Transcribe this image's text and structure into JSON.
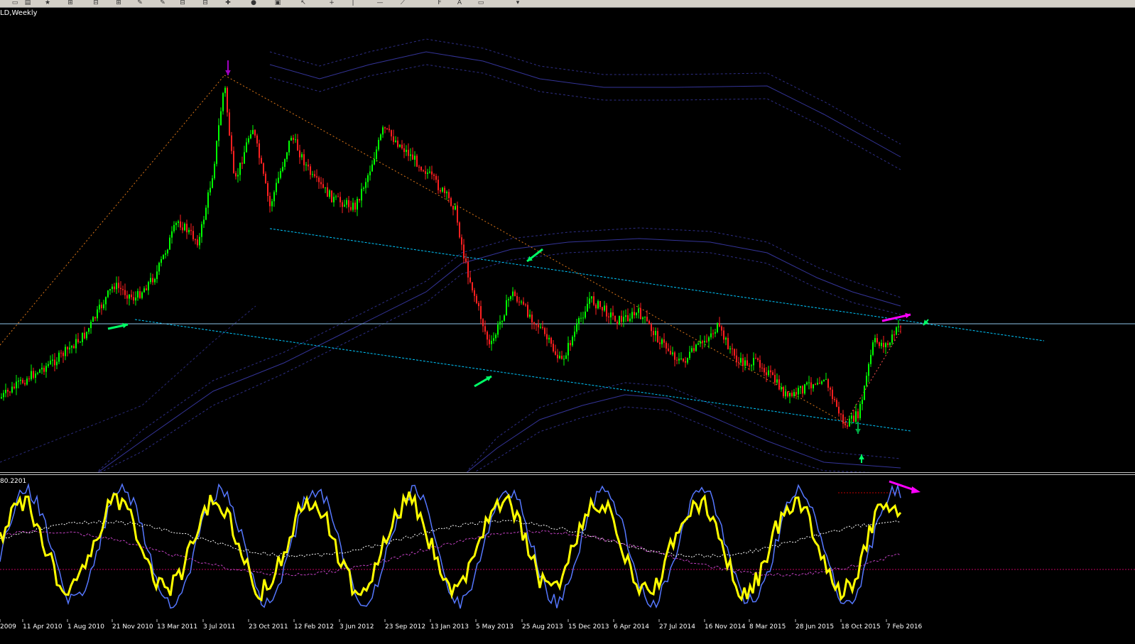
{
  "window": {
    "symbol_label": "LD,Weekly"
  },
  "toolbar": {
    "buttons": [
      {
        "name": "new-chart-icon",
        "glyph": "▭"
      },
      {
        "name": "open-icon",
        "glyph": "▤"
      },
      {
        "name": "favorites-icon",
        "glyph": "★"
      },
      {
        "name": "templates-icon",
        "glyph": "⊞"
      },
      {
        "name": "profile-icon",
        "glyph": "⊟"
      },
      {
        "name": "chart-grid-icon",
        "glyph": "⊞"
      },
      {
        "name": "pencil-icon",
        "glyph": "✎"
      },
      {
        "name": "pencil-alt-icon",
        "glyph": "✎"
      },
      {
        "name": "period-icon",
        "glyph": "⊟"
      },
      {
        "name": "period-alt-icon",
        "glyph": "⊟"
      },
      {
        "name": "new-order-icon",
        "glyph": "✚"
      },
      {
        "name": "autotrading-icon",
        "glyph": "●"
      },
      {
        "name": "navigator-icon",
        "glyph": "▣"
      },
      {
        "name": "cursor-icon",
        "glyph": "↖"
      },
      {
        "name": "crosshair-icon",
        "glyph": "+"
      },
      {
        "name": "vertical-line-icon",
        "glyph": "|"
      },
      {
        "name": "horizontal-line-icon",
        "glyph": "—"
      },
      {
        "name": "trendline-icon",
        "glyph": "⟋"
      },
      {
        "name": "fibo-icon",
        "glyph": "F"
      },
      {
        "name": "text-icon",
        "glyph": "A"
      },
      {
        "name": "label-icon",
        "glyph": "▭"
      },
      {
        "name": "arrows-icon",
        "glyph": "▾"
      }
    ]
  },
  "main_chart": {
    "horizontal_line_color": "#8ec5e8",
    "up_candle_color": "#00ff00",
    "down_candle_color": "#ff2020",
    "channel_line_color": "#00c8ff",
    "envelope_color": "#3a3aa8",
    "zigzag_color": "#e07818",
    "signal_arrow_color": "#00ff66",
    "divergence_arrow_color": "#ff00ff",
    "top_marker_color": "#a000c0"
  },
  "oscillator": {
    "value_label": "80.2201",
    "main_line_color": "#ffff00",
    "signal_line_color": "#5577ff",
    "ma_white_color": "#ffffff",
    "ma_magenta_color": "#c040c0",
    "level_color": "#c00060",
    "upper_level_color": "#c00000"
  },
  "time_axis": {
    "labels": [
      "2009",
      "11 Apr 2010",
      "1 Aug 2010",
      "21 Nov 2010",
      "13 Mar 2011",
      "3 Jul 2011",
      "23 Oct 2011",
      "12 Feb 2012",
      "3 Jun 2012",
      "23 Sep 2012",
      "13 Jan 2013",
      "5 May 2013",
      "25 Aug 2013",
      "15 Dec 2013",
      "6 Apr 2014",
      "27 Jul 2014",
      "16 Nov 2014",
      "8 Mar 2015",
      "28 Jun 2015",
      "18 Oct 2015",
      "7 Feb 2016"
    ]
  }
}
